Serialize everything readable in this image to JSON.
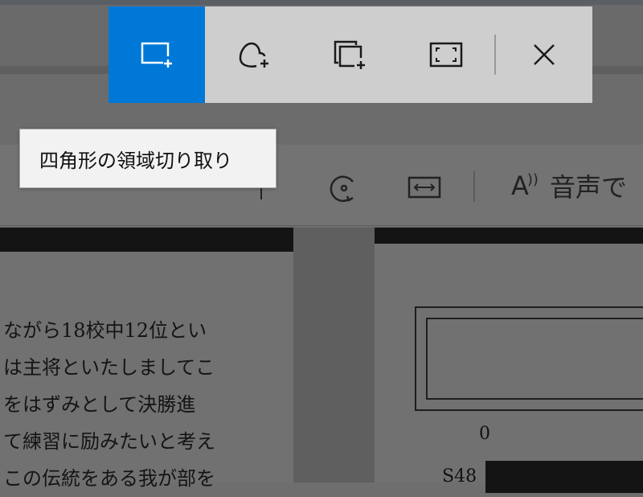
{
  "snip_toolbar": {
    "buttons": [
      {
        "icon": "rectangle-snip-icon",
        "active": true
      },
      {
        "icon": "freeform-snip-icon",
        "active": false
      },
      {
        "icon": "window-snip-icon",
        "active": false
      },
      {
        "icon": "fullscreen-snip-icon",
        "active": false
      }
    ],
    "close_icon": "close-icon",
    "active_color": "#0078d7"
  },
  "tooltip": {
    "text": "四角形の領域切り取り"
  },
  "reader_toolbar": {
    "read_aloud_label": "音声で"
  },
  "document": {
    "lines": [
      "ながら18校中12位とい",
      "は主将といたしましてこ",
      "をはずみとして決勝進",
      "て練習に励みたいと考え",
      "この伝統をある我が部を"
    ],
    "chart_axis_zero": "0",
    "chart_row_label": "S48"
  }
}
